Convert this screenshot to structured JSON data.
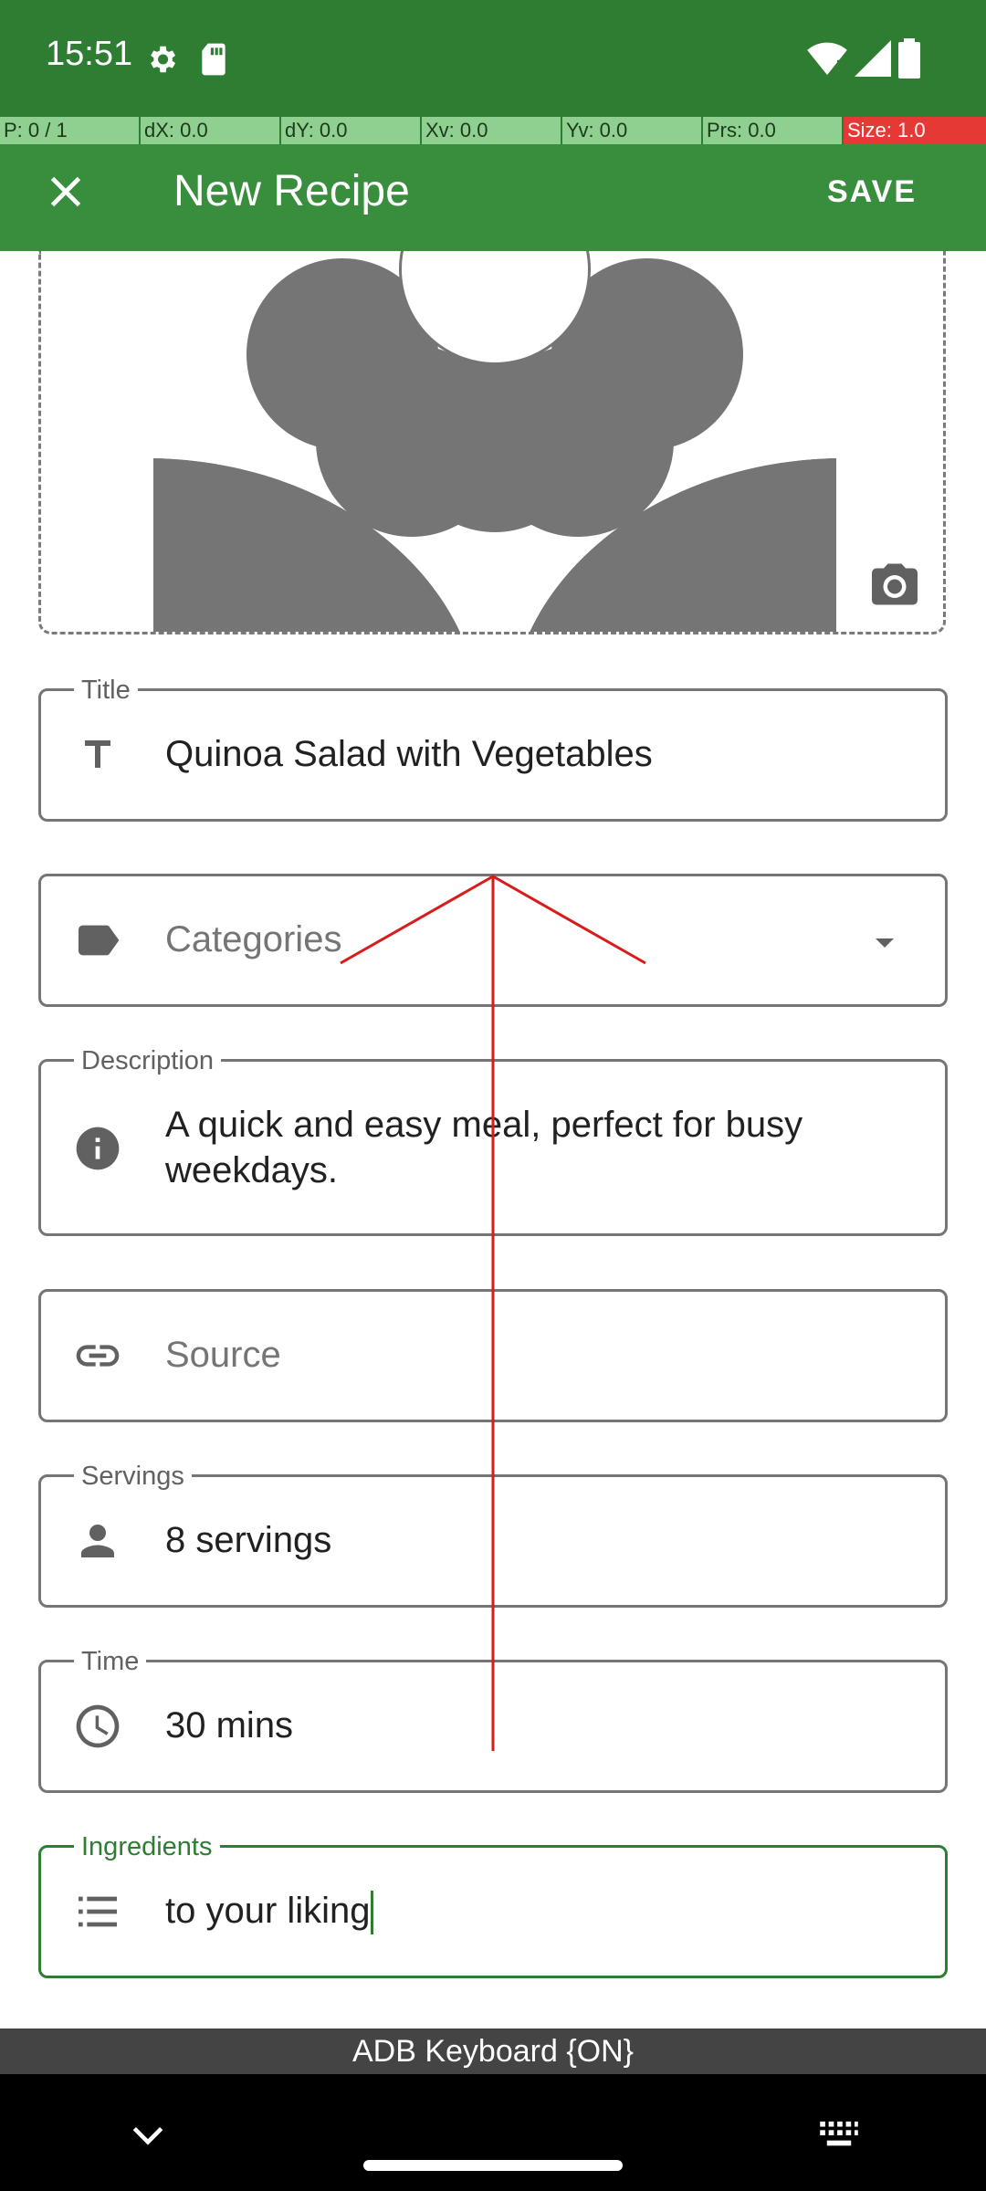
{
  "status_bar": {
    "time": "15:51"
  },
  "pointer_bar": {
    "p": "P: 0 / 1",
    "dx": "dX: 0.0",
    "dy": "dY: 0.0",
    "xv": "Xv: 0.0",
    "yv": "Yv: 0.0",
    "prs": "Prs: 0.0",
    "size": "Size: 1.0"
  },
  "app_bar": {
    "title": "New Recipe",
    "save_label": "SAVE",
    "close_icon": "close-icon"
  },
  "image": {
    "placeholder_icon": "flower-icon",
    "camera_icon": "camera-icon"
  },
  "fields": {
    "title": {
      "label": "Title",
      "value": "Quinoa Salad with Vegetables",
      "icon": "text-icon"
    },
    "categories": {
      "placeholder": "Categories",
      "icon": "label-tag-icon",
      "dropdown_icon": "dropdown-arrow-icon"
    },
    "description": {
      "label": "Description",
      "value": "A quick and easy meal, perfect for busy weekdays.",
      "icon": "info-icon"
    },
    "source": {
      "placeholder": "Source",
      "icon": "link-icon"
    },
    "servings": {
      "label": "Servings",
      "value": "8 servings",
      "icon": "person-icon"
    },
    "time": {
      "label": "Time",
      "value": "30 mins",
      "icon": "clock-icon"
    },
    "ingredients": {
      "label": "Ingredients",
      "value": "to your liking",
      "icon": "list-icon"
    }
  },
  "keyboard": {
    "label": "ADB Keyboard {ON}"
  },
  "colors": {
    "status_bar": "#2e7d32",
    "app_bar": "#388e3c",
    "accent": "#2e7d32",
    "icon_gray": "#616161"
  }
}
